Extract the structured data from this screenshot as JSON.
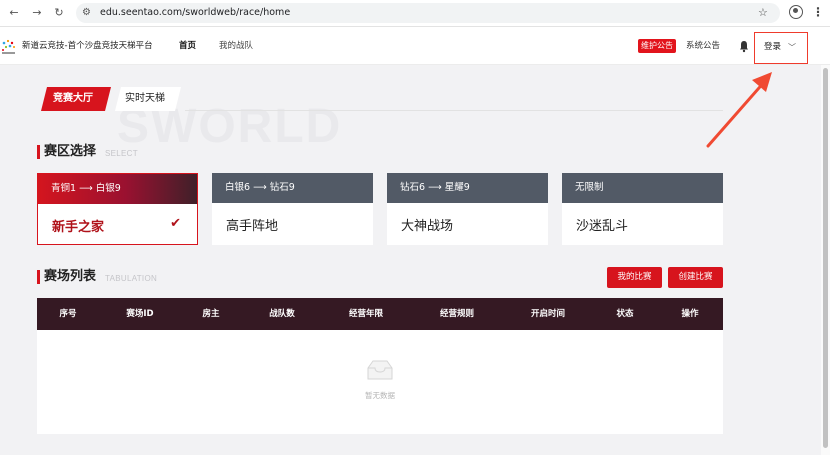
{
  "browser": {
    "url": "edu.seentao.com/sworldweb/race/home",
    "back_icon": "←",
    "forward_icon": "→",
    "reload_icon": "↻",
    "tune_icon": "⚙",
    "star_icon": "☆",
    "menu_icon": "⋮"
  },
  "header": {
    "site_title": "新道云竞技-首个沙盘竞技天梯平台",
    "nav": {
      "home": "首页",
      "my_team": "我的战队"
    },
    "maintenance_badge": "维护公告",
    "system_notice": "系统公告",
    "login": "登录",
    "login_chevron": "﹀"
  },
  "tabs": {
    "hall": "竞赛大厅",
    "ladder": "实时天梯"
  },
  "watermark": "SWORLD",
  "zone_section": {
    "title": "赛区选择",
    "subtitle": "SELECT"
  },
  "zones": [
    {
      "range": "青铜1 ⟶ 白银9",
      "name": "新手之家",
      "selected": true
    },
    {
      "range": "白银6 ⟶ 钻石9",
      "name": "高手阵地"
    },
    {
      "range": "钻石6 ⟶ 星耀9",
      "name": "大神战场"
    },
    {
      "range": "无限制",
      "name": "沙迷乱斗"
    }
  ],
  "check_icon": "✔",
  "list_section": {
    "title": "赛场列表",
    "subtitle": "TABULATION"
  },
  "buttons": {
    "my_matches": "我的比赛",
    "create_match": "创建比赛"
  },
  "table": {
    "columns": [
      "序号",
      "赛场ID",
      "房主",
      "战队数",
      "经营年限",
      "经营规则",
      "开启时间",
      "状态",
      "操作"
    ],
    "empty_text": "暂无数据"
  },
  "colors": {
    "brand_red": "#d7141d",
    "table_header": "#351923",
    "zone_header": "#525a66"
  }
}
